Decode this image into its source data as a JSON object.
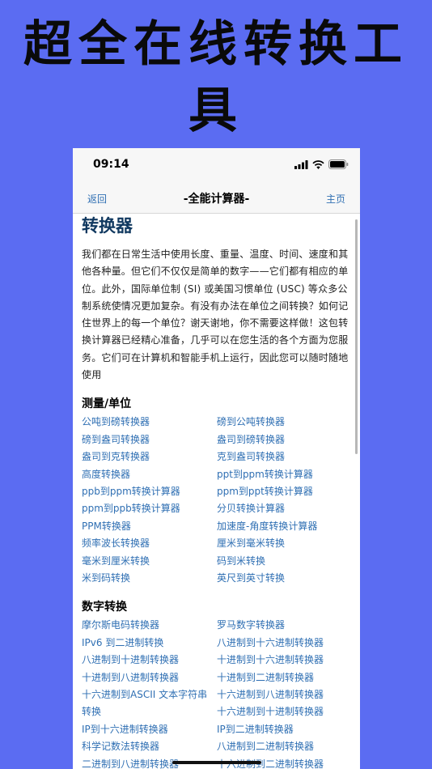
{
  "promo": {
    "line1": "超全在线转换工",
    "line2": "具"
  },
  "status_bar": {
    "time": "09:14",
    "icons": [
      "signal-icon",
      "wifi-icon",
      "battery-icon"
    ]
  },
  "nav": {
    "back": "返回",
    "title": "-全能计算器-",
    "home": "主页"
  },
  "page": {
    "title": "转换器",
    "intro": "我们都在日常生活中使用长度、重量、温度、时间、速度和其他各种量。但它们不仅仅是简单的数字——它们都有相应的单位。此外，国际单位制 (SI) 或美国习惯单位 (USC) 等众多公制系统使情况更加复杂。有没有办法在单位之间转换？如何记住世界上的每一个单位？谢天谢地，你不需要这样做！这包转换计算器已经精心准备，几乎可以在您生活的各个方面为您服务。它们可在计算机和智能手机上运行，因此您可以随时随地使用"
  },
  "sections": [
    {
      "title": "测量/单位",
      "links": [
        "公吨到磅转换器",
        "磅到公吨转换器",
        "磅到盎司转换器",
        "盎司到磅转换器",
        "盎司到克转换器",
        "克到盎司转换器",
        "高度转换器",
        "ppt到ppm转换计算器",
        "ppb到ppm转换计算器",
        "ppm到ppt转换计算器",
        "ppm到ppb转换计算器",
        "分贝转换计算器",
        "PPM转换器",
        "加速度-角度转换计算器",
        "频率波长转换器",
        "厘米到毫米转换",
        "毫米到厘米转换",
        "码到米转换",
        "米到码转换",
        "英尺到英寸转换"
      ]
    },
    {
      "title": "数字转换",
      "links": [
        "摩尔斯电码转换器",
        "罗马数字转换器",
        "IPv6 到二进制转换",
        "八进制到十六进制转换器",
        "八进制到十进制转换器",
        "十进制到十六进制转换器",
        "十进制到八进制转换器",
        "十进制到二进制转换器",
        "十六进制到ASCII 文本字符串",
        "十六进制到八进制转换器",
        "转换",
        "十六进制到十进制转换器",
        "IP到十六进制转换器",
        "IP到二进制转换器",
        "科学记数法转换器",
        "八进制到二进制转换器",
        "二进制到八进制转换器",
        "十六进制到二进制转换器"
      ]
    }
  ],
  "colors": {
    "background": "#5b6cf2",
    "link": "#2f6fb3",
    "heading": "#10385f"
  }
}
